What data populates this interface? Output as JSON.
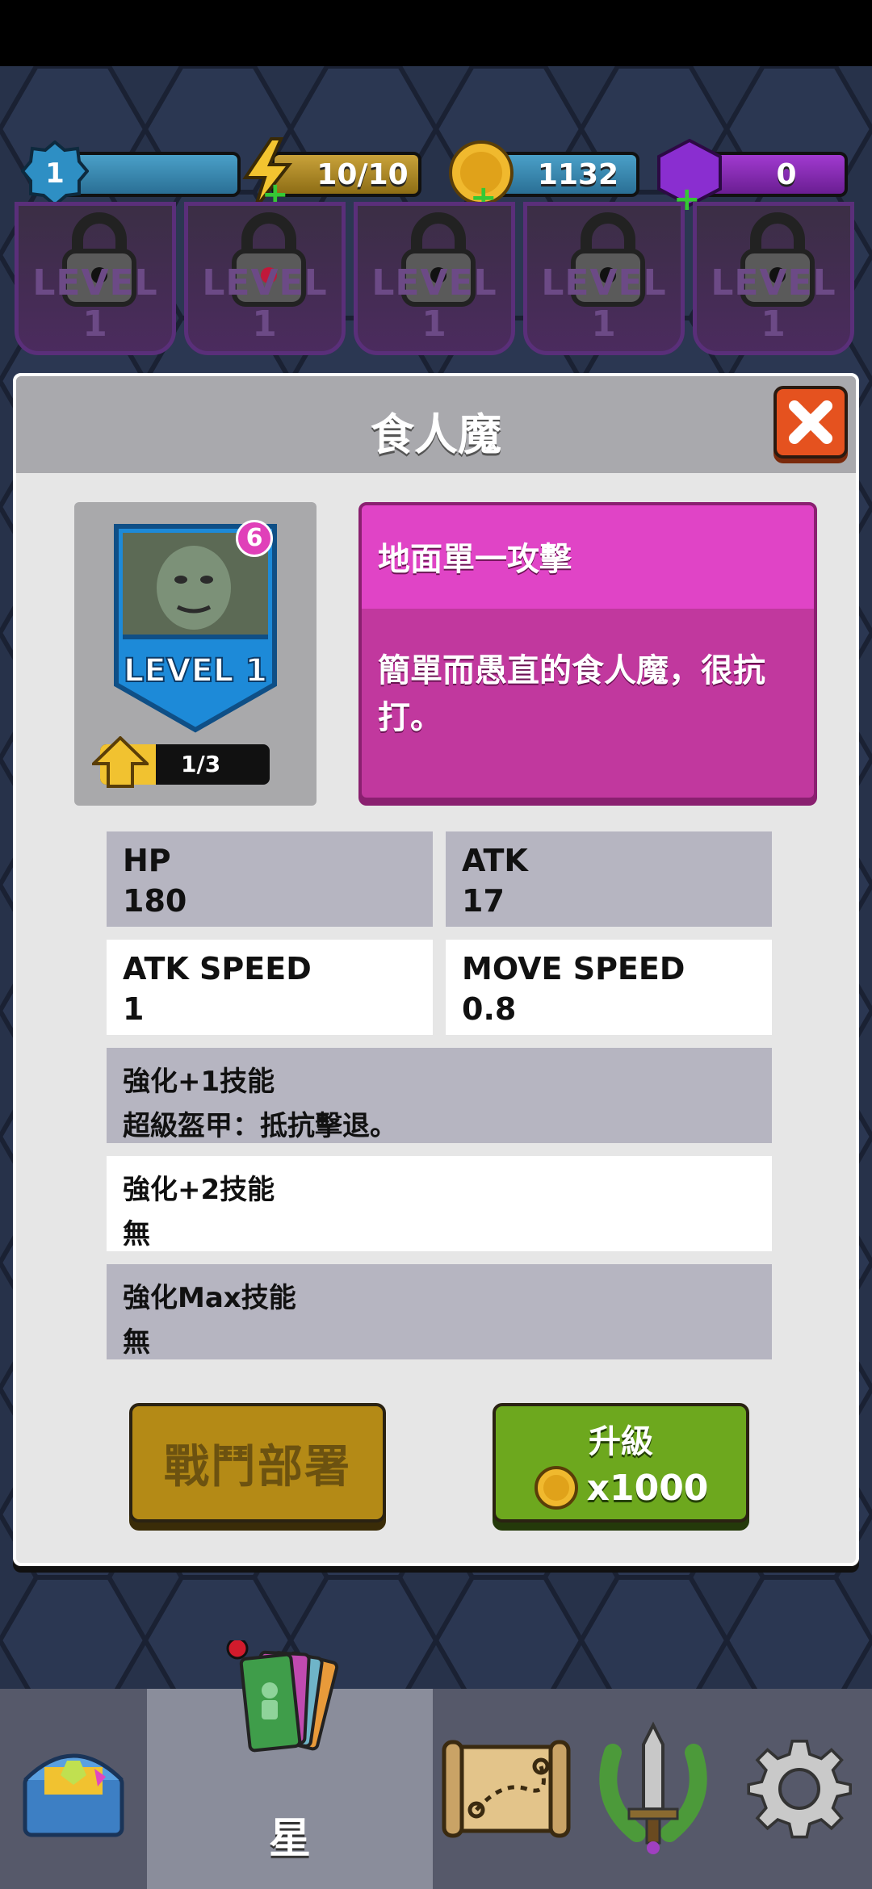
{
  "resources": {
    "level": "1",
    "energy": "10/10",
    "coins": "1132",
    "gems": "0"
  },
  "locked_cards": [
    {
      "label": "LEVEL 1"
    },
    {
      "label": "LEVEL 1"
    },
    {
      "label": "LEVEL 1"
    },
    {
      "label": "LEVEL 1"
    },
    {
      "label": "LEVEL 1"
    }
  ],
  "dialog": {
    "title": "食人魔",
    "card": {
      "level_label": "LEVEL 1",
      "badge": "6",
      "progress_text": "1/3",
      "progress_fraction": 0.33
    },
    "description": {
      "type": "地面單一攻擊",
      "text": "簡單而愚直的食人魔，很抗打。"
    },
    "stats": [
      {
        "key": "HP",
        "value": "180"
      },
      {
        "key": "ATK",
        "value": "17"
      },
      {
        "key": "ATK SPEED",
        "value": "1"
      },
      {
        "key": "MOVE SPEED",
        "value": "0.8"
      }
    ],
    "skills": [
      {
        "key": "強化+1技能",
        "value": "超級盔甲：抵抗擊退。"
      },
      {
        "key": "強化+2技能",
        "value": "無"
      },
      {
        "key": "強化Max技能",
        "value": "無"
      }
    ],
    "buttons": {
      "deploy_label": "戰鬥部署",
      "upgrade_label": "升級",
      "upgrade_cost": "x1000"
    }
  },
  "nav": {
    "active_label": "星"
  },
  "colors": {
    "magenta": "#e044c6",
    "green_button": "#6da81e",
    "gold_button": "#b48a16",
    "close_button": "#e5521f"
  }
}
